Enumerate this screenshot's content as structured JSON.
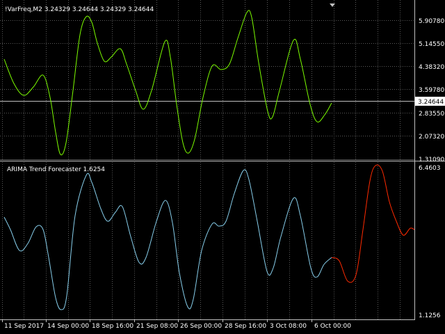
{
  "colors": {
    "background": "#000000",
    "grid": "#5a5a5a",
    "axis_line": "#c0c0c0",
    "text": "#ffffff",
    "price_line": "#c0c0c0",
    "price_tag_bg": "#ffffff",
    "top_series": "#7cfc00",
    "indicator_history": "#87ceeb",
    "indicator_forecast": "#ff2a00",
    "marker": "#c0c0c0"
  },
  "top_pane": {
    "header": "!VarFreq,M2  3.24329 3.24644 3.24329 3.24644",
    "price_tag": "3.24644",
    "price_tag_value": 3.24644,
    "axis_labels": [
      "5.90780",
      "5.14550",
      "4.38320",
      "3.59780",
      "2.83550",
      "2.07320",
      "1.31090"
    ]
  },
  "bottom_pane": {
    "header": "ARIMA Trend Forecaster 1.6254",
    "axis_labels": [
      "6.4603",
      "1.1256"
    ]
  },
  "time_axis": [
    "11 Sep 2017",
    "14 Sep 00:00",
    "18 Sep 16:00",
    "21 Sep 08:00",
    "26 Sep 00:00",
    "28 Sep 16:00",
    "3 Oct 08:00",
    "6 Oct 00:00"
  ],
  "icons": {
    "scroll_marker": "triangle-down-icon"
  }
}
